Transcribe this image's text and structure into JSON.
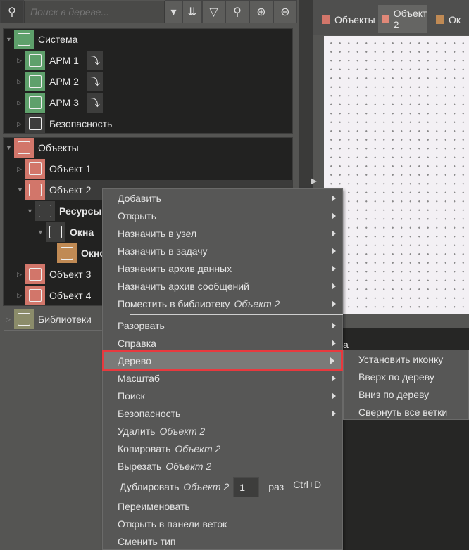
{
  "toolbar": {
    "search_placeholder": "Поиск в дереве...",
    "icons": [
      "tree-structure-icon",
      "dropdown-icon",
      "collapse-icon",
      "filter-icon",
      "search-icon",
      "search-up-icon",
      "search-down-icon"
    ]
  },
  "tabs": [
    {
      "label": "Объекты",
      "color": "#d2766a"
    },
    {
      "label": "Объект 2",
      "color": "#e08878"
    },
    {
      "label": "Ок",
      "color": "#c08a54"
    }
  ],
  "tree": {
    "system": {
      "label": "Система",
      "children": [
        "АРМ 1",
        "АРМ 2",
        "АРМ 3",
        "Безопасность"
      ]
    },
    "objects": {
      "label": "Объекты",
      "obj1": "Объект 1",
      "obj2": "Объект 2",
      "resources": "Ресурсы",
      "windows": "Окна",
      "window": "Окно",
      "obj3": "Объект 3",
      "obj4": "Объект 4"
    },
    "libraries": "Библиотеки"
  },
  "right_panel": {
    "partial_text": "a"
  },
  "context_menu": {
    "target": "Объект 2",
    "items": [
      "Добавить",
      "Открыть",
      "Назначить в узел",
      "Назначить в задачу",
      "Назначить архив данных",
      "Назначить архив сообщений",
      "Поместить в библиотеку"
    ],
    "items2": [
      "Разорвать",
      "Справка",
      "Дерево",
      "Масштаб",
      "Поиск",
      "Безопасность"
    ],
    "delete": "Удалить",
    "copy": "Копировать",
    "cut": "Вырезать",
    "duplicate": "Дублировать",
    "duplicate_count": "1",
    "times": "раз",
    "duplicate_shortcut": "Ctrl+D",
    "rename": "Переименовать",
    "open_branch": "Открыть в панели веток",
    "change_type": "Сменить тип",
    "highlighted": "Дерево",
    "highlight_color": "#e8393e"
  },
  "submenu": {
    "items": [
      "Установить иконку",
      "Вверх по дереву",
      "Вниз по дереву",
      "Свернуть все ветки"
    ]
  }
}
